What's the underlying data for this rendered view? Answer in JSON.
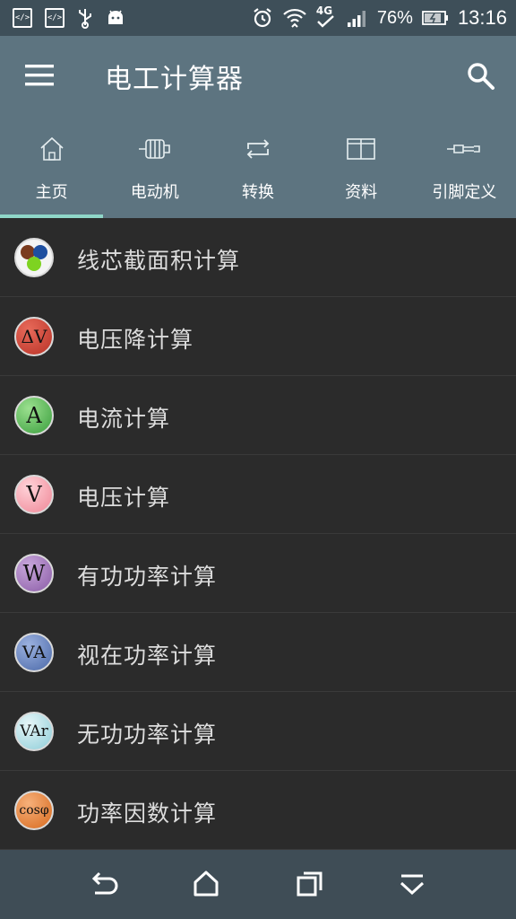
{
  "status_bar": {
    "battery": "76%",
    "time": "13:16",
    "network_badge": "4G",
    "icons": [
      "code-icon",
      "code-icon",
      "usb-icon",
      "android-icon",
      "alarm-icon",
      "wifi-icon",
      "signal-icon",
      "battery-icon"
    ]
  },
  "app_bar": {
    "title": "电工计算器",
    "menu_icon": "hamburger-menu-icon",
    "search_icon": "search-icon"
  },
  "tabs": [
    {
      "label": "主页",
      "icon": "home-icon",
      "active": true
    },
    {
      "label": "电动机",
      "icon": "motor-icon",
      "active": false
    },
    {
      "label": "转换",
      "icon": "swap-icon",
      "active": false
    },
    {
      "label": "资料",
      "icon": "book-icon",
      "active": false
    },
    {
      "label": "引脚定义",
      "icon": "connector-icon",
      "active": false
    }
  ],
  "list": [
    {
      "label": "线芯截面积计算",
      "icon_text": "",
      "icon_color": "#ffffff"
    },
    {
      "label": "电压降计算",
      "icon_text": "ΔV",
      "icon_color": "#c0392b"
    },
    {
      "label": "电流计算",
      "icon_text": "A",
      "icon_color": "#4caf50"
    },
    {
      "label": "电压计算",
      "icon_text": "V",
      "icon_color": "#f29aa8"
    },
    {
      "label": "有功功率计算",
      "icon_text": "W",
      "icon_color": "#9b6fb3"
    },
    {
      "label": "视在功率计算",
      "icon_text": "VA",
      "icon_color": "#5b79b8"
    },
    {
      "label": "无功功率计算",
      "icon_text": "VAr",
      "icon_color": "#9fd6e0"
    },
    {
      "label": "功率因数计算",
      "icon_text": "cosφ",
      "icon_color": "#e07a2e"
    }
  ],
  "nav_bar": {
    "back_icon": "back-icon",
    "home_icon": "home-icon",
    "recents_icon": "recents-icon",
    "hide_icon": "chevron-down-icon"
  }
}
